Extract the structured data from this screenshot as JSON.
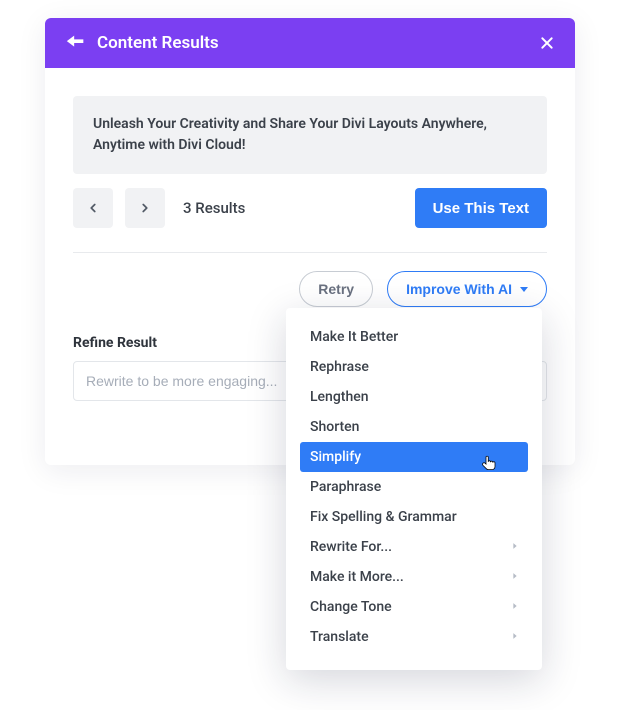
{
  "header": {
    "title": "Content Results"
  },
  "result": {
    "text": "Unleash Your Creativity and Share Your Divi Layouts Anywhere, Anytime with Divi Cloud!"
  },
  "pager": {
    "count_label": "3 Results"
  },
  "buttons": {
    "use_text": "Use This Text",
    "retry": "Retry",
    "improve": "Improve With AI"
  },
  "refine": {
    "label": "Refine Result",
    "placeholder": "Rewrite to be more engaging..."
  },
  "menu": {
    "items": [
      {
        "label": "Make It Better",
        "submenu": false,
        "active": false
      },
      {
        "label": "Rephrase",
        "submenu": false,
        "active": false
      },
      {
        "label": "Lengthen",
        "submenu": false,
        "active": false
      },
      {
        "label": "Shorten",
        "submenu": false,
        "active": false
      },
      {
        "label": "Simplify",
        "submenu": false,
        "active": true
      },
      {
        "label": "Paraphrase",
        "submenu": false,
        "active": false
      },
      {
        "label": "Fix Spelling & Grammar",
        "submenu": false,
        "active": false
      },
      {
        "label": "Rewrite For...",
        "submenu": true,
        "active": false
      },
      {
        "label": "Make it More...",
        "submenu": true,
        "active": false
      },
      {
        "label": "Change Tone",
        "submenu": true,
        "active": false
      },
      {
        "label": "Translate",
        "submenu": true,
        "active": false
      }
    ]
  },
  "colors": {
    "header_bg": "#7B3FF2",
    "primary": "#2f7cf6"
  }
}
